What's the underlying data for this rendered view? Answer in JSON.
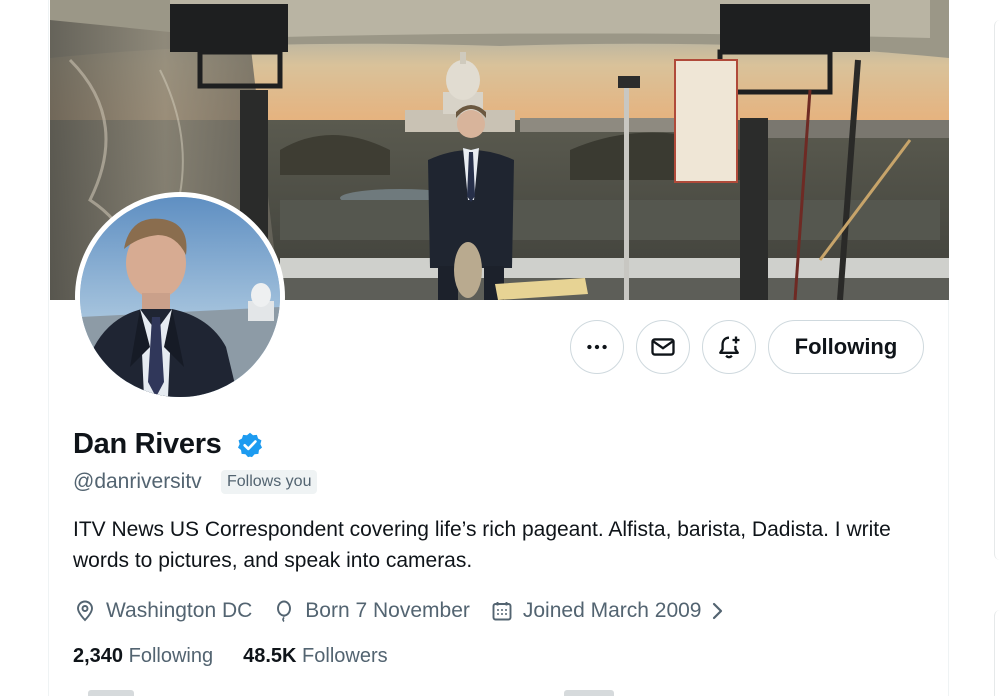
{
  "profile": {
    "display_name": "Dan Rivers",
    "handle": "@danriversitv",
    "follows_you": "Follows you",
    "bio": "ITV News US Correspondent covering life’s rich pageant. Alfista, barista, Dadista. I write words to pictures, and speak into cameras.",
    "location": "Washington DC",
    "birthday": "Born 7 November",
    "joined": "Joined March 2009",
    "following_count": "2,340",
    "following_label": "Following",
    "followers_count": "48.5K",
    "followers_label": "Followers"
  },
  "actions": {
    "follow_state": "Following"
  },
  "icons": {
    "more": "more-icon",
    "message": "mail-icon",
    "notify": "bell-plus-icon",
    "verified": "verified-badge-icon",
    "location": "location-pin-icon",
    "birthday": "balloon-icon",
    "joined": "calendar-icon",
    "chevron": "chevron-right-icon"
  },
  "colors": {
    "verified_blue": "#1d9bf0",
    "secondary_text": "#536471",
    "primary_text": "#0f1419",
    "border": "#cfd9de"
  }
}
